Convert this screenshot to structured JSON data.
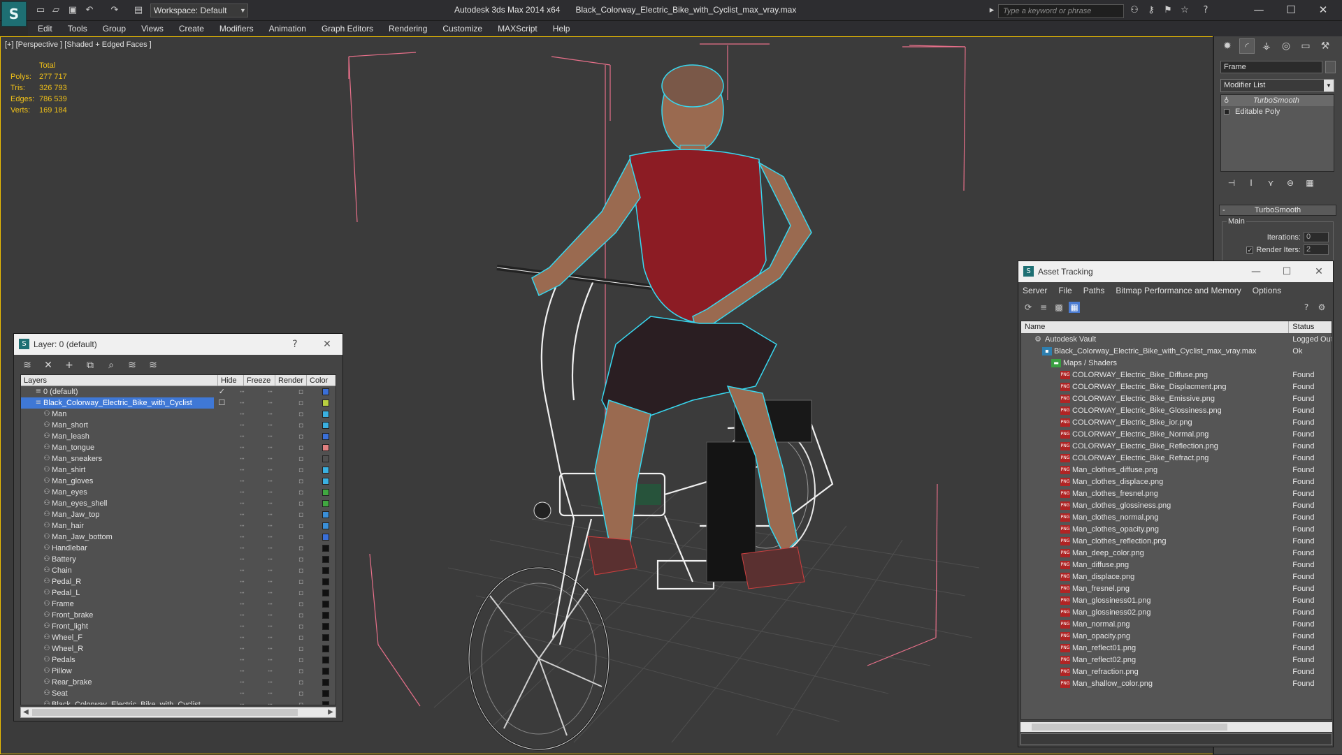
{
  "titlebar": {
    "app_title": "Autodesk 3ds Max  2014 x64",
    "file_name": "Black_Colorway_Electric_Bike_with_Cyclist_max_vray.max",
    "workspace": "Workspace: Default",
    "search_placeholder": "Type a keyword or phrase",
    "icons": [
      "new-icon",
      "open-icon",
      "save-icon",
      "undo-icon",
      "redo-icon",
      "project-icon"
    ]
  },
  "menu": [
    "Edit",
    "Tools",
    "Group",
    "Views",
    "Create",
    "Modifiers",
    "Animation",
    "Graph Editors",
    "Rendering",
    "Customize",
    "MAXScript",
    "Help"
  ],
  "viewport": {
    "label": "[+] [Perspective ] [Shaded + Edged Faces ]",
    "stats": {
      "header": "Total",
      "polys_label": "Polys:",
      "polys": "277 717",
      "tris_label": "Tris:",
      "tris": "326 793",
      "edges_label": "Edges:",
      "edges": "786 539",
      "verts_label": "Verts:",
      "verts": "169 184"
    }
  },
  "layer_panel": {
    "title": "Layer: 0 (default)",
    "help": "?",
    "columns": {
      "layers": "Layers",
      "hide": "Hide",
      "freeze": "Freeze",
      "render": "Render",
      "color": "Color"
    },
    "rows": [
      {
        "name": "0 (default)",
        "level": 0,
        "color": "#3a6fd8",
        "checked": true
      },
      {
        "name": "Black_Colorway_Electric_Bike_with_Cyclist",
        "level": 0,
        "color": "#b8d040",
        "selected": true
      },
      {
        "name": "Man",
        "level": 1,
        "color": "#3ab0e0"
      },
      {
        "name": "Man_short",
        "level": 1,
        "color": "#3ab0e0"
      },
      {
        "name": "Man_leash",
        "level": 1,
        "color": "#3a6fd8"
      },
      {
        "name": "Man_tongue",
        "level": 1,
        "color": "#e08080"
      },
      {
        "name": "Man_sneakers",
        "level": 1,
        "color": "#505050"
      },
      {
        "name": "Man_shirt",
        "level": 1,
        "color": "#3ab0e0"
      },
      {
        "name": "Man_gloves",
        "level": 1,
        "color": "#3ab0e0"
      },
      {
        "name": "Man_eyes",
        "level": 1,
        "color": "#40a840"
      },
      {
        "name": "Man_eyes_shell",
        "level": 1,
        "color": "#40a840"
      },
      {
        "name": "Man_Jaw_top",
        "level": 1,
        "color": "#3a8fd8"
      },
      {
        "name": "Man_hair",
        "level": 1,
        "color": "#3a8fd8"
      },
      {
        "name": "Man_Jaw_bottom",
        "level": 1,
        "color": "#3a6fd8"
      },
      {
        "name": "Handlebar",
        "level": 1,
        "color": "#111111"
      },
      {
        "name": "Battery",
        "level": 1,
        "color": "#111111"
      },
      {
        "name": "Chain",
        "level": 1,
        "color": "#111111"
      },
      {
        "name": "Pedal_R",
        "level": 1,
        "color": "#111111"
      },
      {
        "name": "Pedal_L",
        "level": 1,
        "color": "#111111"
      },
      {
        "name": "Frame",
        "level": 1,
        "color": "#111111"
      },
      {
        "name": "Front_brake",
        "level": 1,
        "color": "#111111"
      },
      {
        "name": "Front_light",
        "level": 1,
        "color": "#111111"
      },
      {
        "name": "Wheel_F",
        "level": 1,
        "color": "#111111"
      },
      {
        "name": "Wheel_R",
        "level": 1,
        "color": "#111111"
      },
      {
        "name": "Pedals",
        "level": 1,
        "color": "#111111"
      },
      {
        "name": "Pillow",
        "level": 1,
        "color": "#111111"
      },
      {
        "name": "Rear_brake",
        "level": 1,
        "color": "#111111"
      },
      {
        "name": "Seat",
        "level": 1,
        "color": "#111111"
      },
      {
        "name": "Black_Colorway_Electric_Bike_with_Cyclist",
        "level": 1,
        "color": "#111111"
      }
    ]
  },
  "command_panel": {
    "object_name": "Frame",
    "modifier_list": "Modifier List",
    "stack": [
      {
        "name": "TurboSmooth",
        "active": true
      },
      {
        "name": "Editable Poly",
        "active": false
      }
    ],
    "rollout": "TurboSmooth",
    "group": "Main",
    "iterations_label": "Iterations:",
    "iterations": "0",
    "render_iters_label": "Render Iters:",
    "render_iters": "2"
  },
  "asset_panel": {
    "title": "Asset Tracking",
    "menu": [
      "Server",
      "File",
      "Paths",
      "Bitmap Performance and Memory",
      "Options"
    ],
    "columns": {
      "name": "Name",
      "status": "Status"
    },
    "rows": [
      {
        "name": "Autodesk Vault",
        "status": "Logged Out",
        "icon": "vault",
        "indent": 1
      },
      {
        "name": "Black_Colorway_Electric_Bike_with_Cyclist_max_vray.max",
        "status": "Ok",
        "icon": "max",
        "indent": 2
      },
      {
        "name": "Maps / Shaders",
        "status": "",
        "icon": "folder",
        "indent": 3
      },
      {
        "name": "COLORWAY_Electric_Bike_Diffuse.png",
        "status": "Found",
        "icon": "png",
        "indent": 4
      },
      {
        "name": "COLORWAY_Electric_Bike_Displacment.png",
        "status": "Found",
        "icon": "png",
        "indent": 4
      },
      {
        "name": "COLORWAY_Electric_Bike_Emissive.png",
        "status": "Found",
        "icon": "png",
        "indent": 4
      },
      {
        "name": "COLORWAY_Electric_Bike_Glossiness.png",
        "status": "Found",
        "icon": "png",
        "indent": 4
      },
      {
        "name": "COLORWAY_Electric_Bike_ior.png",
        "status": "Found",
        "icon": "png",
        "indent": 4
      },
      {
        "name": "COLORWAY_Electric_Bike_Normal.png",
        "status": "Found",
        "icon": "png",
        "indent": 4
      },
      {
        "name": "COLORWAY_Electric_Bike_Reflection.png",
        "status": "Found",
        "icon": "png",
        "indent": 4
      },
      {
        "name": "COLORWAY_Electric_Bike_Refract.png",
        "status": "Found",
        "icon": "png",
        "indent": 4
      },
      {
        "name": "Man_clothes_diffuse.png",
        "status": "Found",
        "icon": "png",
        "indent": 4
      },
      {
        "name": "Man_clothes_displace.png",
        "status": "Found",
        "icon": "png",
        "indent": 4
      },
      {
        "name": "Man_clothes_fresnel.png",
        "status": "Found",
        "icon": "png",
        "indent": 4
      },
      {
        "name": "Man_clothes_glossiness.png",
        "status": "Found",
        "icon": "png",
        "indent": 4
      },
      {
        "name": "Man_clothes_normal.png",
        "status": "Found",
        "icon": "png",
        "indent": 4
      },
      {
        "name": "Man_clothes_opacity.png",
        "status": "Found",
        "icon": "png",
        "indent": 4
      },
      {
        "name": "Man_clothes_reflection.png",
        "status": "Found",
        "icon": "png",
        "indent": 4
      },
      {
        "name": "Man_deep_color.png",
        "status": "Found",
        "icon": "png",
        "indent": 4
      },
      {
        "name": "Man_diffuse.png",
        "status": "Found",
        "icon": "png",
        "indent": 4
      },
      {
        "name": "Man_displace.png",
        "status": "Found",
        "icon": "png",
        "indent": 4
      },
      {
        "name": "Man_fresnel.png",
        "status": "Found",
        "icon": "png",
        "indent": 4
      },
      {
        "name": "Man_glossiness01.png",
        "status": "Found",
        "icon": "png",
        "indent": 4
      },
      {
        "name": "Man_glossiness02.png",
        "status": "Found",
        "icon": "png",
        "indent": 4
      },
      {
        "name": "Man_normal.png",
        "status": "Found",
        "icon": "png",
        "indent": 4
      },
      {
        "name": "Man_opacity.png",
        "status": "Found",
        "icon": "png",
        "indent": 4
      },
      {
        "name": "Man_reflect01.png",
        "status": "Found",
        "icon": "png",
        "indent": 4
      },
      {
        "name": "Man_reflect02.png",
        "status": "Found",
        "icon": "png",
        "indent": 4
      },
      {
        "name": "Man_refraction.png",
        "status": "Found",
        "icon": "png",
        "indent": 4
      },
      {
        "name": "Man_shallow_color.png",
        "status": "Found",
        "icon": "png",
        "indent": 4
      }
    ]
  },
  "colors": {
    "viewport_border": "#f0c000",
    "stats_text": "#f0c018",
    "selection": "#3f78d6",
    "bbox": "#e8708a"
  }
}
